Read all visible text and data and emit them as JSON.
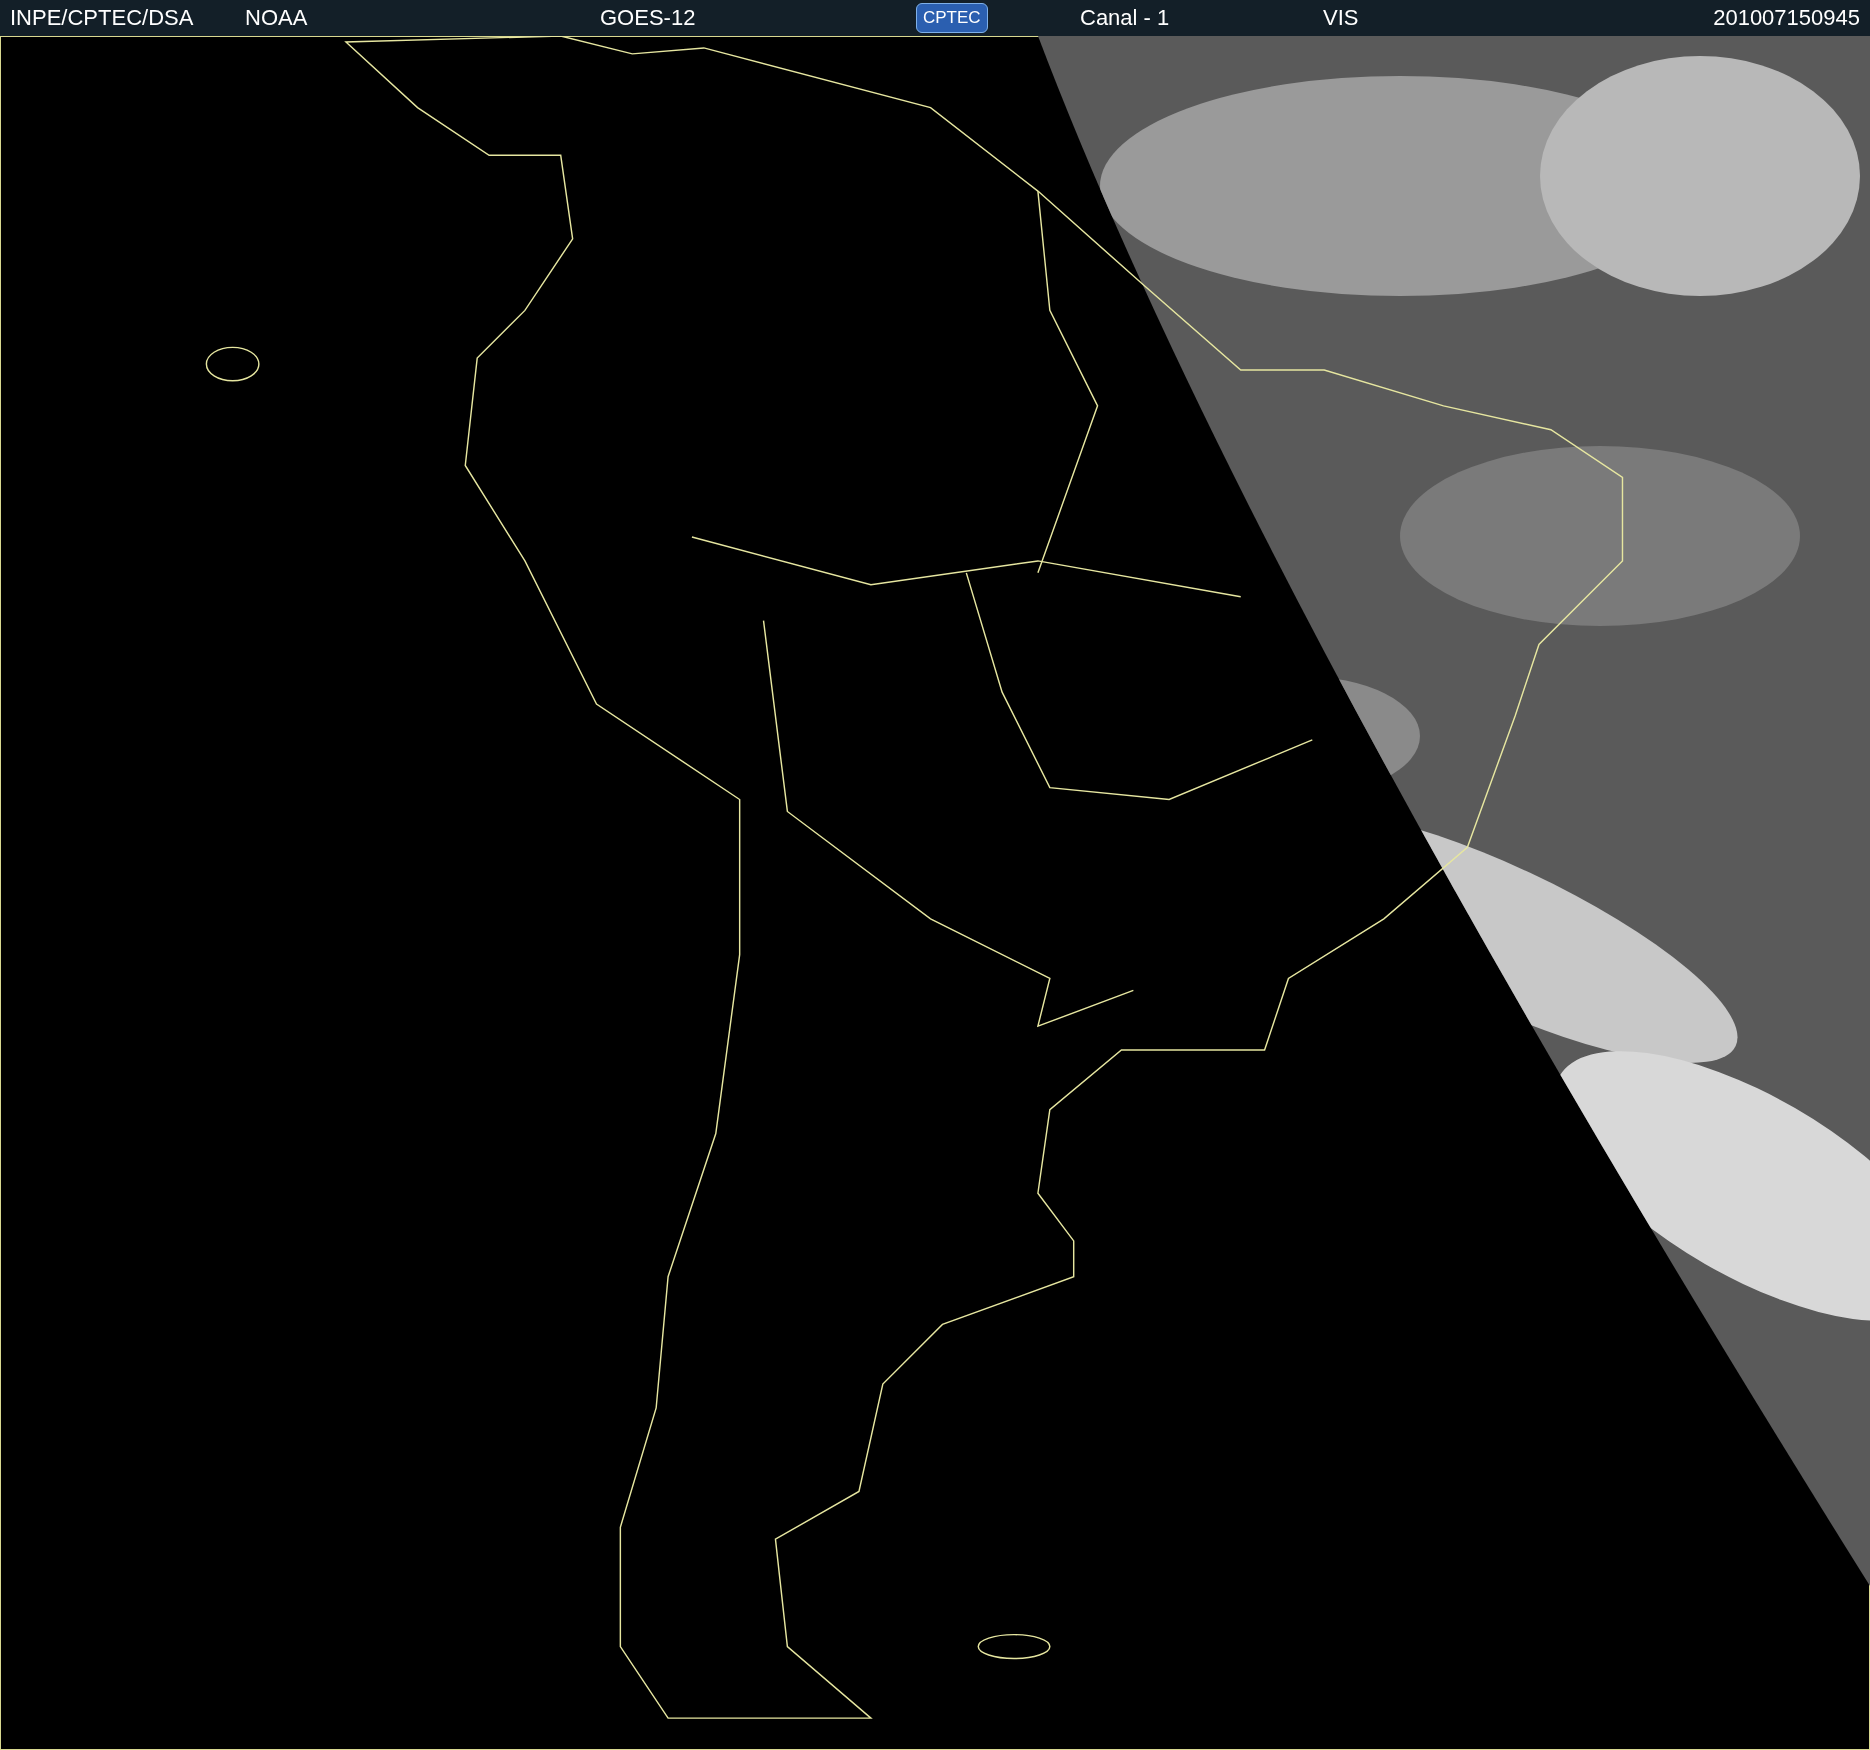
{
  "header": {
    "source": "INPE/CPTEC/DSA",
    "agency": "NOAA",
    "satellite": "GOES-12",
    "logo": "CPTEC",
    "channel": "Canal - 1",
    "band": "VIS",
    "timestamp": "201007150945"
  }
}
